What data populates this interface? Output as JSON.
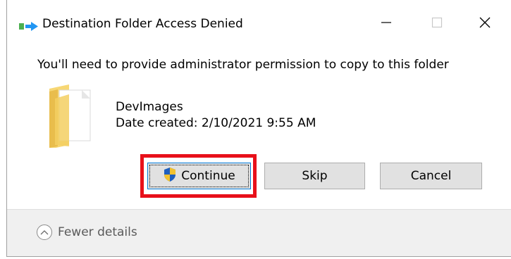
{
  "window": {
    "title": "Destination Folder Access Denied",
    "controls": {
      "minimize": "minimize-icon",
      "maximize": "maximize-icon",
      "close": "close-icon"
    }
  },
  "message": "You'll need to provide administrator permission to copy to this folder",
  "item": {
    "name": "DevImages",
    "date_created": "Date created: 2/10/2021 9:55 AM",
    "icon": "folder-icon"
  },
  "buttons": {
    "continue_label": "Continue",
    "skip_label": "Skip",
    "cancel_label": "Cancel"
  },
  "footer": {
    "details_label": "Fewer details"
  },
  "colors": {
    "highlight": "#e8101a",
    "focus_border": "#0078d7",
    "button_bg": "#e1e1e1",
    "footer_bg": "#f0f0f0"
  }
}
